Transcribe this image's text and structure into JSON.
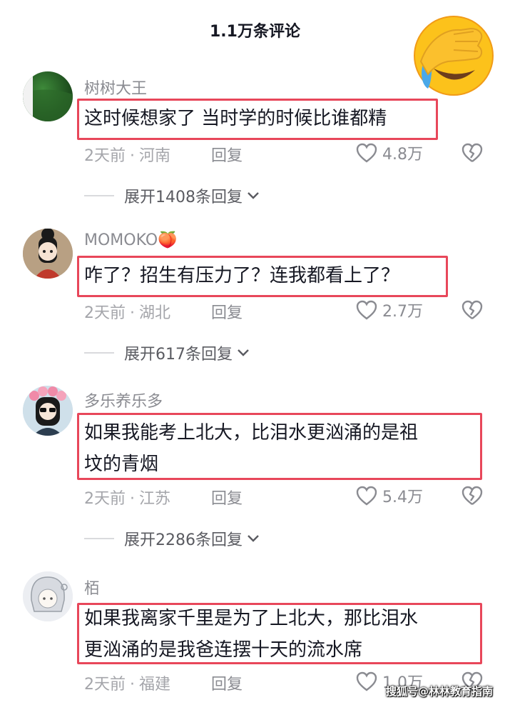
{
  "header": {
    "title": "1.1万条评论",
    "emoji": "face-palm-crying-emoji"
  },
  "colors": {
    "highlight_box": "#e8475a",
    "meta_gray": "#a4a5aa",
    "username_gray": "#8a8b91"
  },
  "comments": [
    {
      "username": "树树大王",
      "text_lines": [
        "这时候想家了 当时学的时候比谁都精"
      ],
      "time": "2天前",
      "location": "河南",
      "reply_label": "回复",
      "likes": "4.8万",
      "expand_label": "展开1408条回复",
      "avatar": "green-texture-avatar"
    },
    {
      "username": "MOMOKO🍑",
      "text_lines": [
        "咋了？招生有压力了？连我都看上了？"
      ],
      "time": "2天前",
      "location": "湖北",
      "reply_label": "回复",
      "likes": "2.7万",
      "expand_label": "展开617条回复",
      "avatar": "anime-girl-avatar"
    },
    {
      "username": "多乐养乐多",
      "text_lines": [
        "如果我能考上北大，比泪水更汹涌的是祖",
        "坟的青烟"
      ],
      "time": "2天前",
      "location": "江苏",
      "reply_label": "回复",
      "likes": "5.4万",
      "expand_label": "展开2286条回复",
      "avatar": "flower-crown-sunglasses-avatar"
    },
    {
      "username": "栢",
      "text_lines": [
        "如果我离家千里是为了上北大，那比泪水",
        "更汹涌的是我爸连摆十天的流水席"
      ],
      "time": "2天前",
      "location": "福建",
      "reply_label": "回复",
      "likes": "1.0万",
      "avatar": "white-hair-anime-avatar"
    }
  ],
  "watermark": "搜狐号@林林教育指南"
}
